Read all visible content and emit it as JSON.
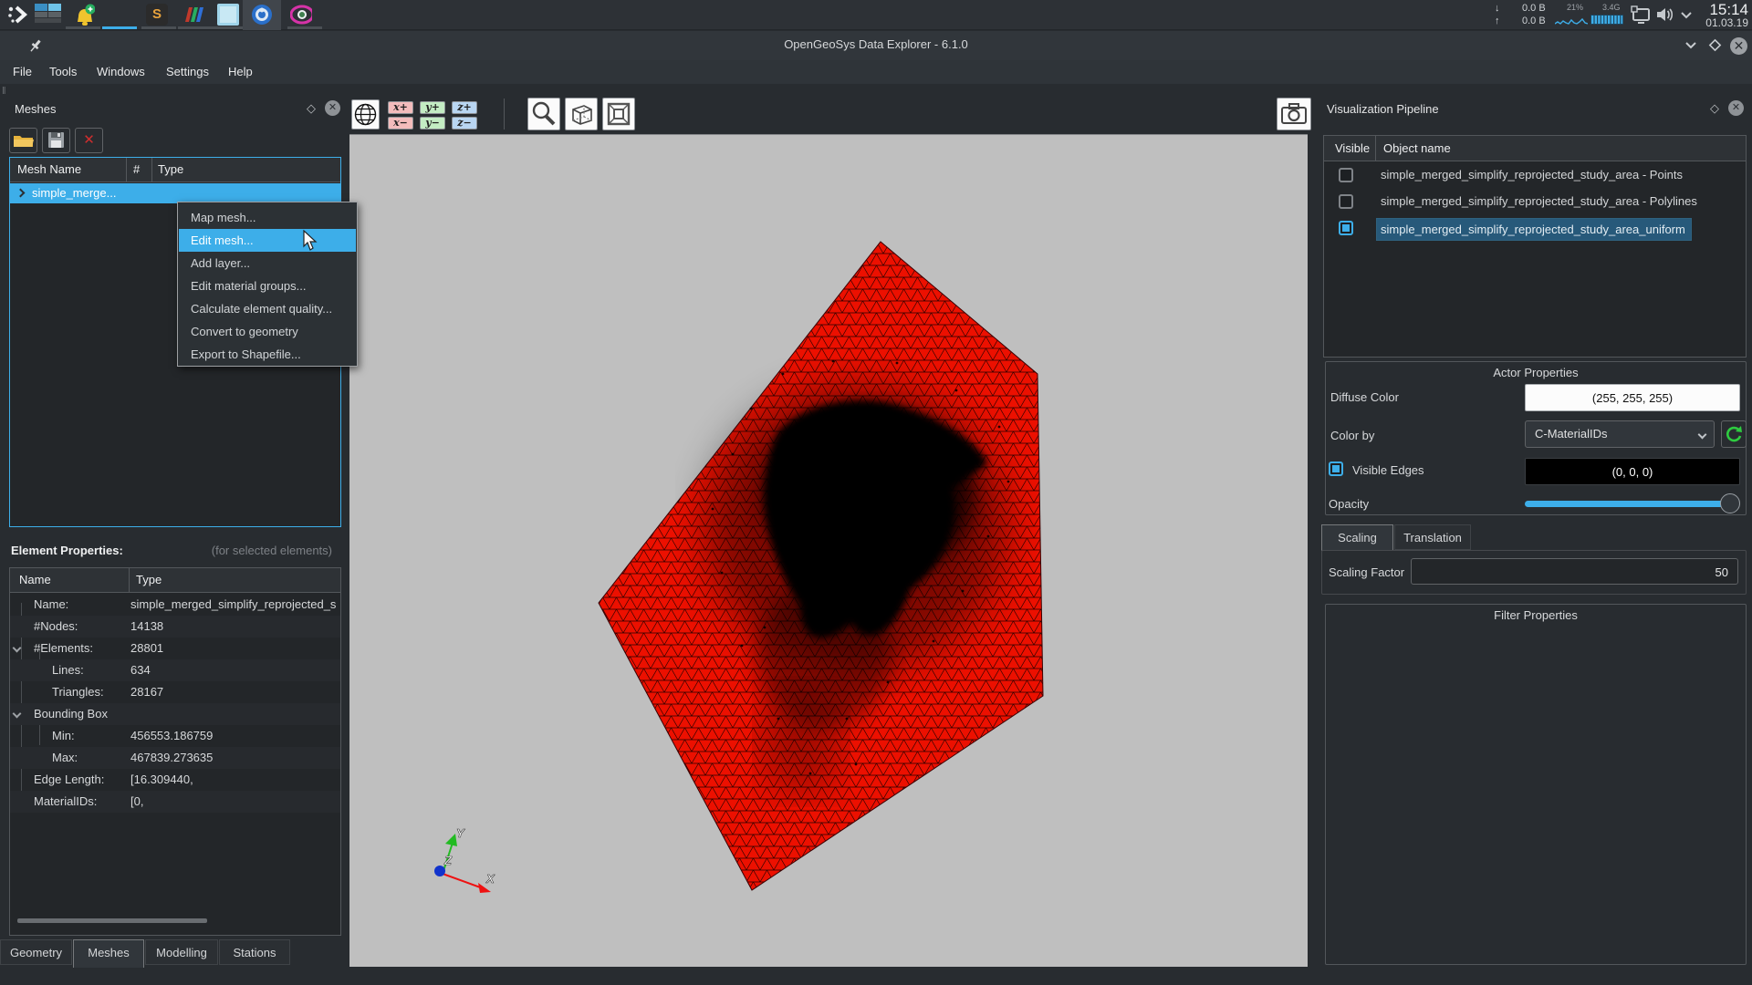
{
  "taskbar": {
    "stats": {
      "down": "0.0 B",
      "up": "0.0 B",
      "cpu": "21%",
      "mem": "3.4G"
    },
    "clock": {
      "time": "15:14",
      "date": "01.03.19"
    }
  },
  "titlebar": {
    "title": "OpenGeoSys Data Explorer - 6.1.0"
  },
  "menubar": {
    "items": [
      "File",
      "Tools",
      "Windows",
      "Settings",
      "Help"
    ]
  },
  "meshes_panel": {
    "title": "Meshes",
    "columns": [
      "Mesh Name",
      "#",
      "Type"
    ],
    "rows": [
      {
        "name": "simple_merge..."
      }
    ]
  },
  "context_menu": {
    "items": [
      "Map mesh...",
      "Edit mesh...",
      "Add layer...",
      "Edit material groups...",
      "Calculate element quality...",
      "Convert to geometry",
      "Export to Shapefile..."
    ],
    "highlighted": "Edit mesh..."
  },
  "element_properties": {
    "label": "Element Properties:",
    "hint": "(for selected elements)",
    "columns": [
      "Name",
      "Type"
    ],
    "rows": [
      {
        "name": "Name:",
        "value": "simple_merged_simplify_reprojected_s"
      },
      {
        "name": "#Nodes:",
        "value": "14138"
      },
      {
        "name": "#Elements:",
        "value": "28801"
      },
      {
        "name": "Lines:",
        "value": "634"
      },
      {
        "name": "Triangles:",
        "value": "28167"
      },
      {
        "name": "Bounding Box",
        "value": ""
      },
      {
        "name": "Min:",
        "value": "456553.186759"
      },
      {
        "name": "Max:",
        "value": "467839.273635"
      },
      {
        "name": "Edge Length:",
        "value": "[16.309440,"
      },
      {
        "name": "MaterialIDs:",
        "value": "[0,"
      }
    ]
  },
  "bottom_tabs": {
    "items": [
      "Geometry",
      "Meshes",
      "Modelling",
      "Stations"
    ],
    "active": "Meshes"
  },
  "viewport_toolbar": {
    "axis_buttons": [
      "x+",
      "y+",
      "z+",
      "x−",
      "y−",
      "z−"
    ]
  },
  "viewport": {
    "axis_labels": {
      "x": "X",
      "y": "Y",
      "z": "Z"
    }
  },
  "pipeline_panel": {
    "title": "Visualization Pipeline",
    "columns": [
      "Visible",
      "Object name"
    ],
    "rows": [
      {
        "name": "simple_merged_simplify_reprojected_study_area - Points",
        "checked": false
      },
      {
        "name": "simple_merged_simplify_reprojected_study_area - Polylines",
        "checked": false
      },
      {
        "name": "simple_merged_simplify_reprojected_study_area_uniform",
        "checked": true
      }
    ]
  },
  "actor_properties": {
    "title": "Actor Properties",
    "diffuse_label": "Diffuse Color",
    "diffuse_value": "(255, 255, 255)",
    "colorby_label": "Color by",
    "colorby_value": "C-MaterialIDs",
    "edges_label": "Visible Edges",
    "edges_value": "(0, 0, 0)",
    "opacity_label": "Opacity",
    "tabs": [
      "Scaling",
      "Translation"
    ],
    "active_tab": "Scaling",
    "scaling_label": "Scaling Factor",
    "scaling_value": "50"
  },
  "filter_properties": {
    "title": "Filter Properties"
  },
  "colors": {
    "highlight": "#3daee9",
    "mesh_red": "#ec1000",
    "selection_row": "#27597a",
    "viewport_bg": "#bfbfbf"
  }
}
